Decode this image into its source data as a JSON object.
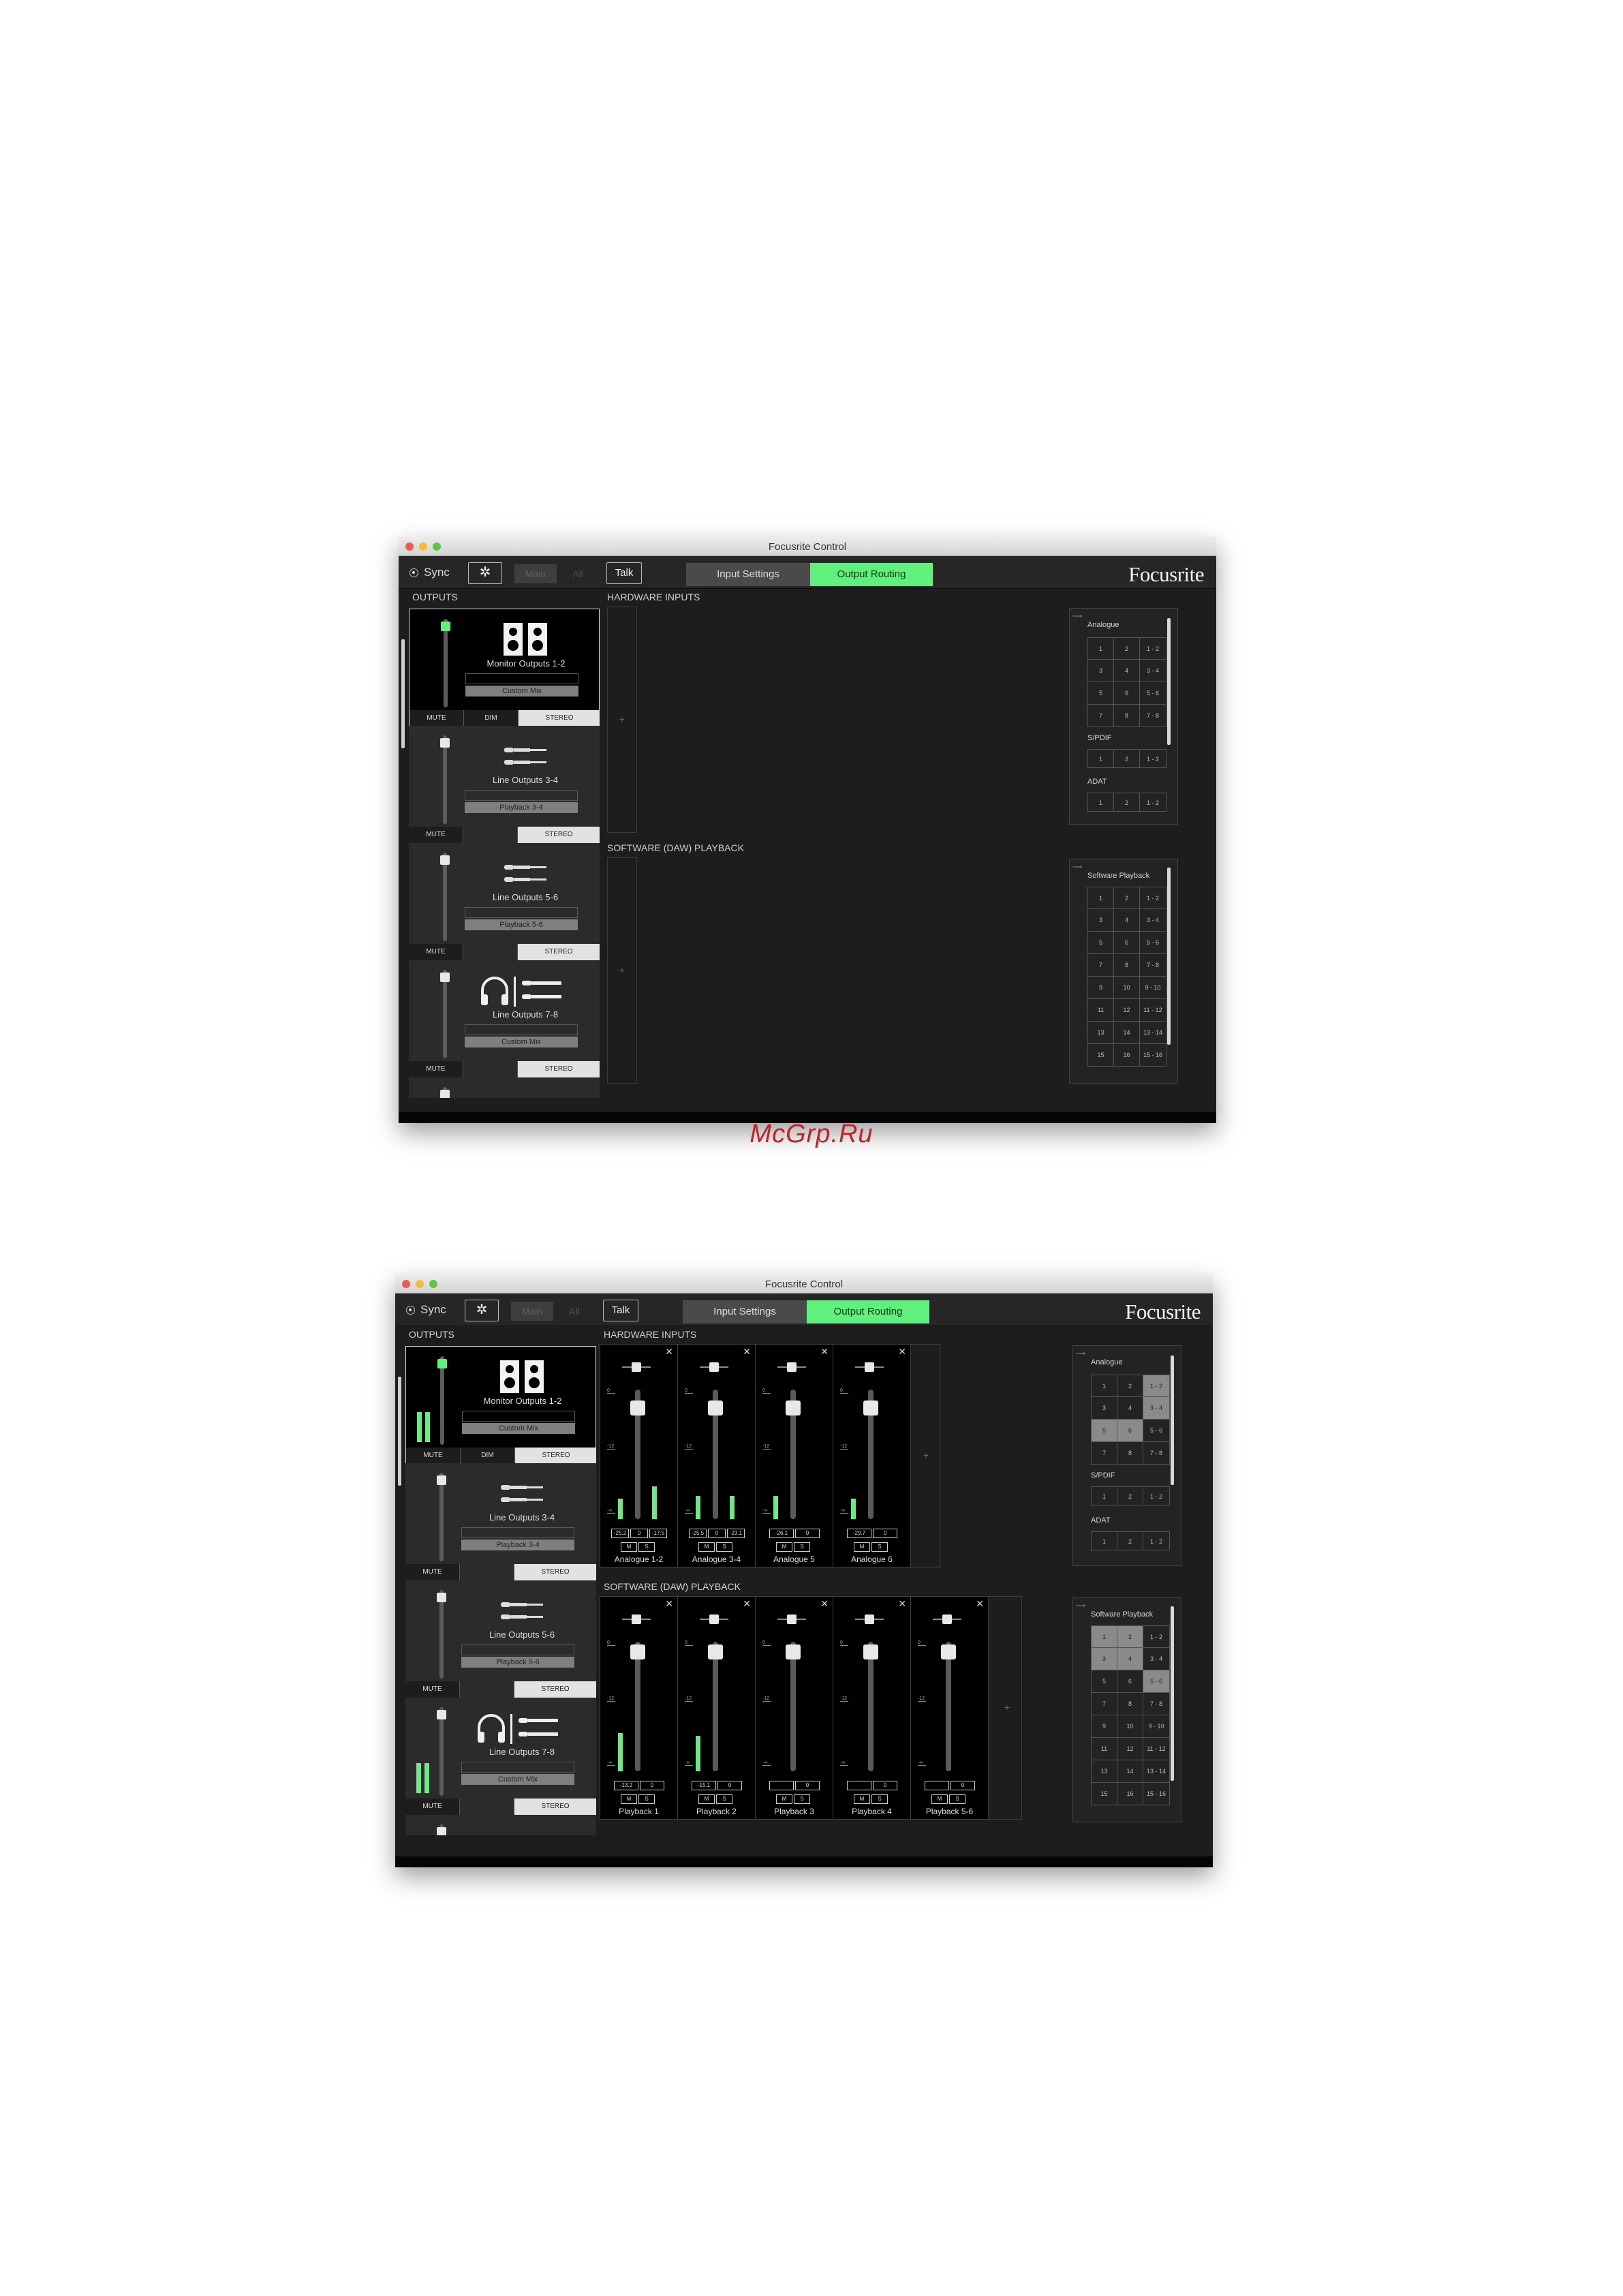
{
  "window": {
    "title": "Focusrite Control",
    "sync_label": "Sync",
    "main_label": "Main",
    "all_label": "All",
    "talk_label": "Talk",
    "tab_input_settings": "Input Settings",
    "tab_output_routing": "Output Routing",
    "logo": "Focusrite",
    "gear_glyph": "✲"
  },
  "sections": {
    "outputs": "OUTPUTS",
    "hardware_inputs": "HARDWARE INPUTS",
    "software_playback": "SOFTWARE (DAW) PLAYBACK",
    "plus": "+"
  },
  "outputs": [
    {
      "name": "Monitor Outputs 1-2",
      "source": "Custom Mix",
      "buttons": [
        "MUTE",
        "DIM",
        "STEREO"
      ]
    },
    {
      "name": "Line Outputs 3-4",
      "source": "Playback 3-4",
      "buttons": [
        "MUTE",
        "STEREO"
      ]
    },
    {
      "name": "Line Outputs 5-6",
      "source": "Playback 5-6",
      "buttons": [
        "MUTE",
        "STEREO"
      ]
    },
    {
      "name": "Line Outputs 7-8",
      "source": "Custom Mix",
      "buttons": [
        "MUTE",
        "STEREO"
      ]
    }
  ],
  "routing": {
    "analogue_label": "Analogue",
    "spdif_label": "S/PDIF",
    "adat_label": "ADAT",
    "software_playback_label": "Software Playback",
    "analogue_rows": [
      [
        "1",
        "2",
        "1 - 2"
      ],
      [
        "3",
        "4",
        "3 - 4"
      ],
      [
        "5",
        "6",
        "5 - 6"
      ],
      [
        "7",
        "8",
        "7 - 8"
      ]
    ],
    "spdif_rows": [
      [
        "1",
        "2",
        "1 - 2"
      ]
    ],
    "adat_rows": [
      [
        "1",
        "2",
        "1 - 2"
      ]
    ],
    "playback_rows": [
      [
        "1",
        "2",
        "1 - 2"
      ],
      [
        "3",
        "4",
        "3 - 4"
      ],
      [
        "5",
        "6",
        "5 - 6"
      ],
      [
        "7",
        "8",
        "7 - 8"
      ],
      [
        "9",
        "10",
        "9 - 10"
      ],
      [
        "11",
        "12",
        "11 - 12"
      ],
      [
        "13",
        "14",
        "13 - 14"
      ],
      [
        "15",
        "16",
        "15 - 16"
      ]
    ]
  },
  "hardware_channels": [
    {
      "name": "Analogue 1-2",
      "levels": [
        "-25.2",
        "0",
        "-17.5"
      ],
      "mute": "M",
      "solo": "S"
    },
    {
      "name": "Analogue 3-4",
      "levels": [
        "-25.5",
        "0",
        "-23.1"
      ],
      "mute": "M",
      "solo": "S"
    },
    {
      "name": "Analogue 5",
      "levels": [
        "-26.1",
        "0"
      ],
      "mute": "M",
      "solo": "S"
    },
    {
      "name": "Analogue 6",
      "levels": [
        "-29.7",
        "0"
      ],
      "mute": "M",
      "solo": "S"
    }
  ],
  "playback_channels": [
    {
      "name": "Playback 1",
      "levels": [
        "-13.2",
        "0"
      ],
      "mute": "M",
      "solo": "S"
    },
    {
      "name": "Playback 2",
      "levels": [
        "-15.1",
        "0"
      ],
      "mute": "M",
      "solo": "S"
    },
    {
      "name": "Playback 3",
      "levels": [
        "",
        "0"
      ],
      "mute": "M",
      "solo": "S"
    },
    {
      "name": "Playback 4",
      "levels": [
        "",
        "0"
      ],
      "mute": "M",
      "solo": "S"
    },
    {
      "name": "Playback 5-6",
      "levels": [
        "",
        "0"
      ],
      "mute": "M",
      "solo": "S"
    }
  ],
  "fader_scale": [
    "0",
    "-12",
    "-∞"
  ],
  "watermark": "McGrp.Ru",
  "colors": {
    "accent": "#5ff07e",
    "background": "#1d1d1d"
  }
}
